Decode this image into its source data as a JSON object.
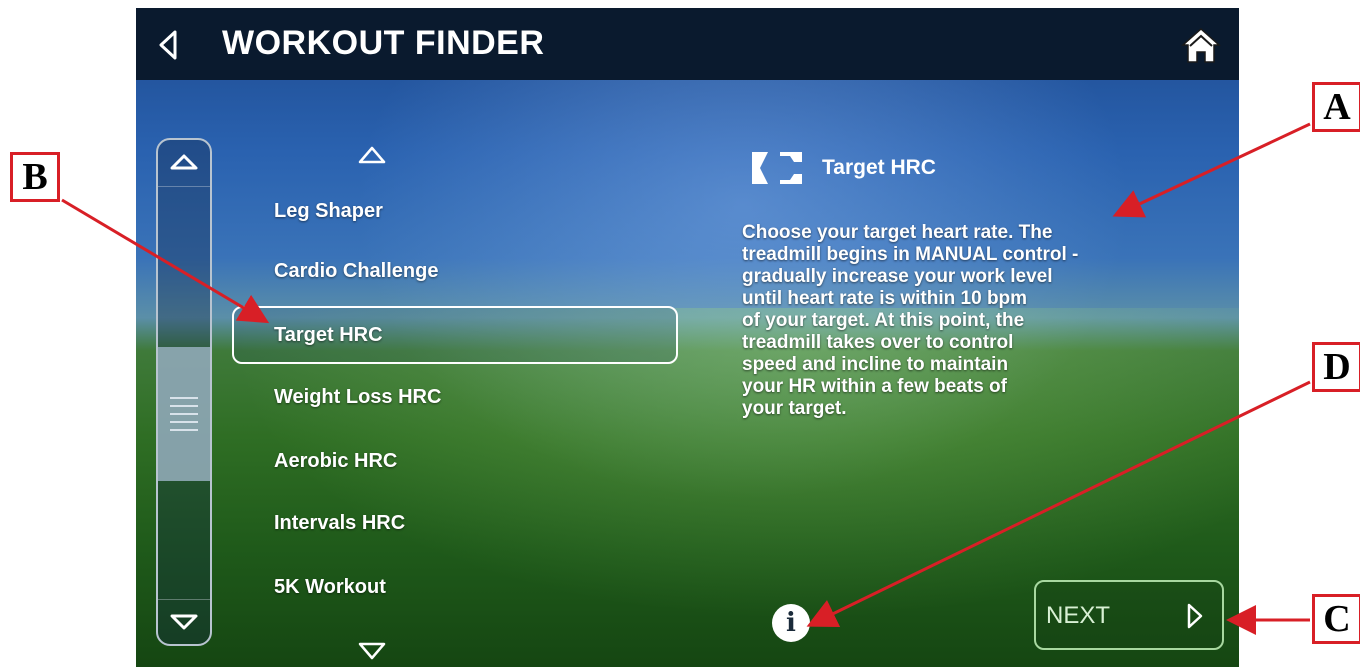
{
  "header": {
    "title": "WORKOUT FINDER",
    "back_icon": "back-chevron-icon",
    "home_icon": "home-icon"
  },
  "workout_list": {
    "items": [
      {
        "label": "Leg Shaper",
        "selected": false
      },
      {
        "label": "Cardio Challenge",
        "selected": false
      },
      {
        "label": "Target HRC",
        "selected": true
      },
      {
        "label": "Weight Loss HRC",
        "selected": false
      },
      {
        "label": "Aerobic HRC",
        "selected": false
      },
      {
        "label": "Intervals HRC",
        "selected": false
      },
      {
        "label": "5K Workout",
        "selected": false
      }
    ]
  },
  "detail": {
    "title": "Target HRC",
    "icon": "target-hrc-icon",
    "description_lines": [
      "Choose your target heart rate. The",
      "treadmill begins in MANUAL control -",
      "gradually increase your work level",
      "until heart rate is within 10 bpm",
      "of your target. At this point, the",
      "treadmill takes over to control",
      "speed and incline to maintain",
      "your HR within a few beats of",
      "your target."
    ]
  },
  "footer": {
    "info_icon": "info-icon",
    "next_label": "NEXT"
  },
  "callouts": {
    "a": "A",
    "b": "B",
    "c": "C",
    "d": "D"
  },
  "colors": {
    "topbar": "#0a1a2e",
    "callout_red": "#d81f26",
    "next_border": "#a8d8a0"
  }
}
